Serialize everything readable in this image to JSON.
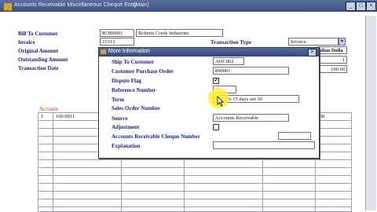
{
  "window": {
    "title": "Accounts Receivable Miscellaneous Cheque Entry",
    "mode": "(Main)",
    "min_label": "_",
    "max_label": "□",
    "close_label": "×"
  },
  "header": {
    "bill_to_label": "Bill To Customer",
    "bill_to_code": "ROB0001",
    "bill_to_name": "Roberts Creek Industries",
    "invoice_label": "Invoice",
    "invoice_value": "21313",
    "transaction_type_label": "Transaction Type",
    "transaction_type_value": "Invoice",
    "original_amount_label": "Original Amount",
    "outstanding_amount_label": "Outstanding Amount",
    "transaction_date_label": "Transaction Date",
    "currency_partial": "dian Dolla",
    "rate_partial": "1",
    "amount_partial": "100.00"
  },
  "account": {
    "section_label": "Account",
    "rows": [
      {
        "num": "1",
        "account": "100.0911",
        "amount_partial": ".00"
      }
    ]
  },
  "modal": {
    "title": "More Information",
    "close_label": "×",
    "ship_to_label": "Ship To Customer",
    "ship_to_value": "AOC002",
    "po_label": "Customer Purchase Order",
    "po_value": "890001",
    "dispute_label": "Dispute Flag",
    "dispute_checked": "✔",
    "reference_label": "Reference Number",
    "reference_value": "",
    "term_label": "Term",
    "term_code": "2",
    "term_value": "2% 15 days net 30",
    "sales_order_label": "Sales Order Number",
    "source_label": "Source",
    "source_value": "Accounts Receivable",
    "adjustment_label": "Adjustment",
    "ar_cheque_label": "Accounts Receivable Cheque Number",
    "explanation_label": "Explanation",
    "explanation_value": ""
  }
}
